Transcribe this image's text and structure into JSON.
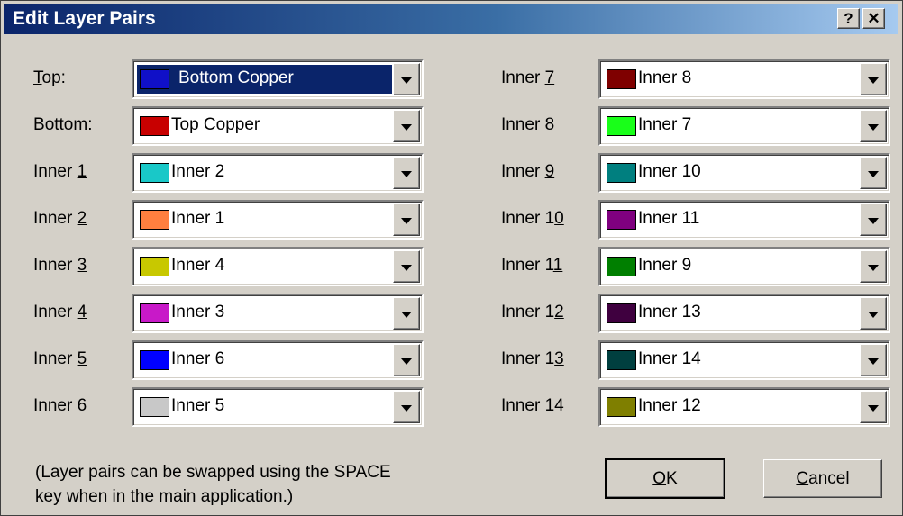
{
  "title": "Edit Layer Pairs",
  "titlebar": {
    "help_label": "?",
    "close_label": "✕"
  },
  "rows_left": [
    {
      "label_pre": "",
      "label_key": "T",
      "label_post": "op:",
      "value": "Bottom Copper",
      "color": "#1010c8"
    },
    {
      "label_pre": "",
      "label_key": "B",
      "label_post": "ottom:",
      "value": "Top Copper",
      "color": "#c80000"
    },
    {
      "label_pre": "Inner ",
      "label_key": "1",
      "label_post": "",
      "value": "Inner 2",
      "color": "#19c8c8"
    },
    {
      "label_pre": "Inner ",
      "label_key": "2",
      "label_post": "",
      "value": "Inner 1",
      "color": "#ff7f3f"
    },
    {
      "label_pre": "Inner ",
      "label_key": "3",
      "label_post": "",
      "value": "Inner 4",
      "color": "#c8c800"
    },
    {
      "label_pre": "Inner ",
      "label_key": "4",
      "label_post": "",
      "value": "Inner 3",
      "color": "#c819c8"
    },
    {
      "label_pre": "Inner ",
      "label_key": "5",
      "label_post": "",
      "value": "Inner 6",
      "color": "#0000ff"
    },
    {
      "label_pre": "Inner ",
      "label_key": "6",
      "label_post": "",
      "value": "Inner 5",
      "color": "#c8c8c8"
    }
  ],
  "rows_right": [
    {
      "label_pre": "Inner ",
      "label_key": "7",
      "label_post": "",
      "value": "Inner 8",
      "color": "#7f0000"
    },
    {
      "label_pre": "Inner ",
      "label_key": "8",
      "label_post": "",
      "value": "Inner 7",
      "color": "#19ff19"
    },
    {
      "label_pre": "Inner ",
      "label_key": "9",
      "label_post": "",
      "value": "Inner 10",
      "color": "#007f7f"
    },
    {
      "label_pre": "Inner 1",
      "label_key": "0",
      "label_post": "",
      "value": "Inner 11",
      "color": "#7f007f"
    },
    {
      "label_pre": "Inner 1",
      "label_key": "1",
      "label_post": "",
      "value": "Inner 9",
      "color": "#007f00"
    },
    {
      "label_pre": "Inner 1",
      "label_key": "2",
      "label_post": "",
      "value": "Inner 13",
      "color": "#3f003f"
    },
    {
      "label_pre": "Inner 1",
      "label_key": "3",
      "label_post": "",
      "value": "Inner 14",
      "color": "#003f3f"
    },
    {
      "label_pre": "Inner 1",
      "label_key": "4",
      "label_post": "",
      "value": "Inner 12",
      "color": "#7f7f00"
    }
  ],
  "note": "(Layer pairs can be swapped using the SPACE\nkey when in the main application.)",
  "buttons": {
    "ok_key": "O",
    "ok_rest": "K",
    "cancel_key": "C",
    "cancel_rest": "ancel"
  }
}
